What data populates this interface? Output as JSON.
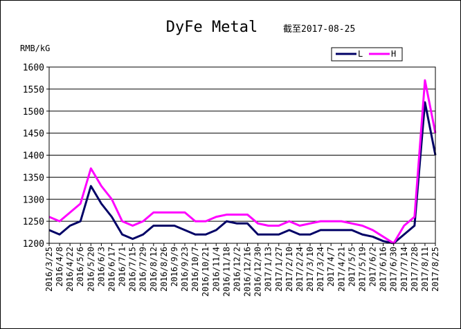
{
  "chart_data": {
    "type": "line",
    "title": "DyFe Metal",
    "subtitle": "截至2017-08-25",
    "ylabel": "RMB/kG",
    "ylim": [
      1200,
      1600
    ],
    "yticks": [
      1200,
      1250,
      1300,
      1350,
      1400,
      1450,
      1500,
      1550,
      1600
    ],
    "grid": true,
    "legend_position": "top-right",
    "x": [
      "2016/3/25",
      "2016/4/8",
      "2016/4/22",
      "2016/5/6",
      "2016/5/20",
      "2016/6/3",
      "2016/6/17",
      "2016/7/1",
      "2016/7/15",
      "2016/7/29",
      "2016/8/12",
      "2016/8/26",
      "2016/9/9",
      "2016/9/23",
      "2016/10/7",
      "2016/10/21",
      "2016/11/4",
      "2016/11/18",
      "2016/12/2",
      "2016/12/16",
      "2016/12/30",
      "2017/1/13",
      "2017/1/27",
      "2017/2/10",
      "2017/2/24",
      "2017/3/10",
      "2017/3/24",
      "2017/4/7",
      "2017/4/21",
      "2017/5/5",
      "2017/5/19",
      "2017/6/2",
      "2017/6/16",
      "2017/6/30",
      "2017/7/14",
      "2017/7/28",
      "2017/8/11",
      "2017/8/25"
    ],
    "series": [
      {
        "name": "L",
        "color": "#000066",
        "values": [
          1230,
          1220,
          1240,
          1250,
          1330,
          1290,
          1260,
          1220,
          1210,
          1220,
          1240,
          1240,
          1240,
          1230,
          1220,
          1220,
          1230,
          1250,
          1245,
          1245,
          1220,
          1220,
          1220,
          1230,
          1220,
          1220,
          1230,
          1230,
          1230,
          1230,
          1220,
          1215,
          1205,
          1195,
          1220,
          1240,
          1520,
          1400
        ]
      },
      {
        "name": "H",
        "color": "#ff00ff",
        "values": [
          1260,
          1250,
          1270,
          1290,
          1370,
          1330,
          1300,
          1250,
          1240,
          1250,
          1270,
          1270,
          1270,
          1270,
          1250,
          1250,
          1260,
          1265,
          1265,
          1265,
          1245,
          1240,
          1240,
          1250,
          1240,
          1245,
          1250,
          1250,
          1250,
          1245,
          1240,
          1230,
          1215,
          1200,
          1240,
          1260,
          1570,
          1450
        ]
      }
    ]
  }
}
